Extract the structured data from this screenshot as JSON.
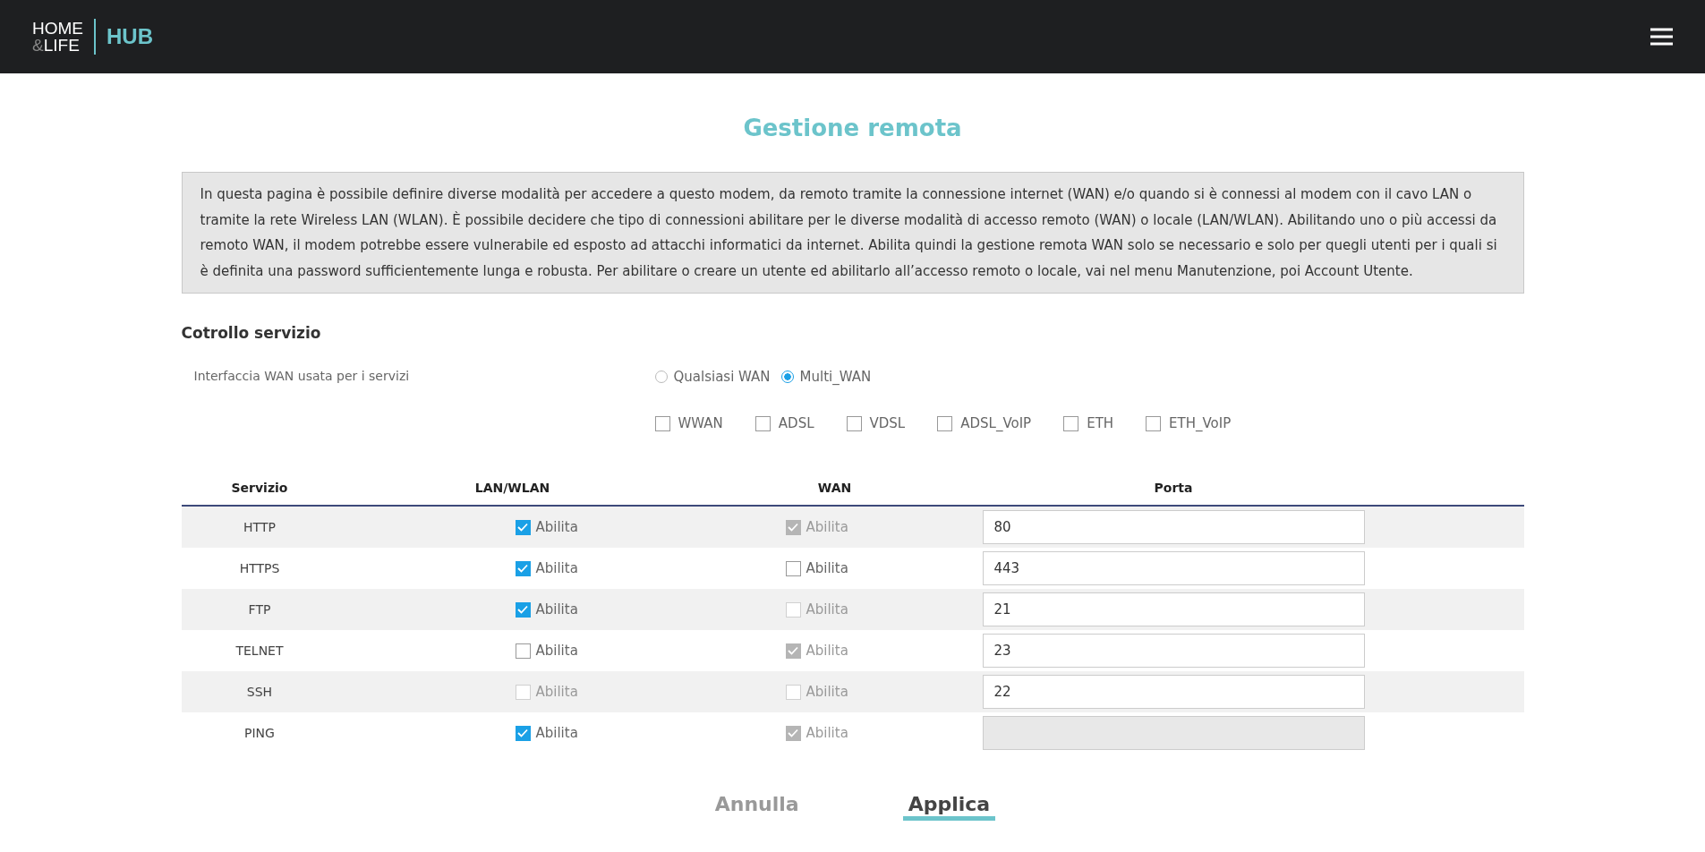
{
  "header": {
    "logo_top": "HOME",
    "logo_amp": "&",
    "logo_bottom": "LIFE",
    "logo_hub": "HUB"
  },
  "title": "Gestione remota",
  "info": "In questa pagina è possibile definire diverse modalità per accedere a questo modem, da remoto tramite la connessione internet (WAN) e/o quando si è connessi al modem con il cavo LAN o tramite la rete Wireless LAN (WLAN). È possibile decidere che tipo di connessioni abilitare per le diverse modalità di accesso remoto (WAN) o locale (LAN/WLAN). Abilitando uno o più accessi da remoto WAN, il modem potrebbe essere vulnerabile ed esposto ad attacchi informatici da internet. Abilita quindi la gestione remota WAN solo se necessario e solo per quegli utenti per i quali si è definita una password sufficientemente lunga e robusta. Per abilitare o creare un utente ed abilitarlo all’accesso remoto o locale, vai nel menu Manutenzione, poi Account Utente.",
  "section": "Cotrollo servizio",
  "interface": {
    "label": "Interfaccia WAN usata per i servizi",
    "radios": [
      {
        "label": "Qualsiasi WAN",
        "selected": false
      },
      {
        "label": "Multi_WAN",
        "selected": true
      }
    ],
    "wans": [
      {
        "label": "WWAN",
        "checked": false
      },
      {
        "label": "ADSL",
        "checked": false
      },
      {
        "label": "VDSL",
        "checked": false
      },
      {
        "label": "ADSL_VoIP",
        "checked": false
      },
      {
        "label": "ETH",
        "checked": false
      },
      {
        "label": "ETH_VoIP",
        "checked": false
      }
    ]
  },
  "table": {
    "columns": [
      "Servizio",
      "LAN/WLAN",
      "WAN",
      "Porta"
    ],
    "rows": [
      {
        "service": "HTTP",
        "lan": {
          "label": "Abilita",
          "checked": true,
          "disabled": false
        },
        "wan": {
          "label": "Abilita",
          "checked": true,
          "disabled": true
        },
        "port": {
          "value": "80",
          "disabled": false
        }
      },
      {
        "service": "HTTPS",
        "lan": {
          "label": "Abilita",
          "checked": true,
          "disabled": false
        },
        "wan": {
          "label": "Abilita",
          "checked": false,
          "disabled": false
        },
        "port": {
          "value": "443",
          "disabled": false
        }
      },
      {
        "service": "FTP",
        "lan": {
          "label": "Abilita",
          "checked": true,
          "disabled": false
        },
        "wan": {
          "label": "Abilita",
          "checked": false,
          "disabled": true
        },
        "port": {
          "value": "21",
          "disabled": false
        }
      },
      {
        "service": "TELNET",
        "lan": {
          "label": "Abilita",
          "checked": false,
          "disabled": false
        },
        "wan": {
          "label": "Abilita",
          "checked": true,
          "disabled": true
        },
        "port": {
          "value": "23",
          "disabled": false
        }
      },
      {
        "service": "SSH",
        "lan": {
          "label": "Abilita",
          "checked": false,
          "disabled": true
        },
        "wan": {
          "label": "Abilita",
          "checked": false,
          "disabled": true
        },
        "port": {
          "value": "22",
          "disabled": false
        }
      },
      {
        "service": "PING",
        "lan": {
          "label": "Abilita",
          "checked": true,
          "disabled": false
        },
        "wan": {
          "label": "Abilita",
          "checked": true,
          "disabled": true
        },
        "port": {
          "disabled": true
        }
      }
    ]
  },
  "buttons": {
    "cancel": "Annulla",
    "apply": "Applica"
  }
}
